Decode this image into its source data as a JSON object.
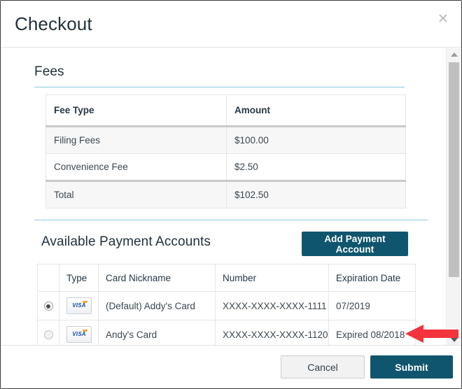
{
  "modal": {
    "title": "Checkout",
    "close_icon": "close-x-icon"
  },
  "fees": {
    "heading": "Fees",
    "columns": [
      "Fee Type",
      "Amount"
    ],
    "rows": [
      {
        "type": "Filing Fees",
        "amount": "$100.00"
      },
      {
        "type": "Convenience Fee",
        "amount": "$2.50"
      },
      {
        "type": "Total",
        "amount": "$102.50"
      }
    ]
  },
  "payment_accounts": {
    "heading": "Available Payment Accounts",
    "add_button_label": "Add Payment Account",
    "columns": [
      "",
      "Type",
      "Card Nickname",
      "Number",
      "Expiration Date"
    ],
    "rows": [
      {
        "selected": "true",
        "card_type": "VISA",
        "nickname": "(Default) Addy's Card",
        "number": "XXXX-XXXX-XXXX-1111",
        "expiration": "07/2019",
        "expired": "false"
      },
      {
        "selected": "false",
        "card_type": "VISA",
        "nickname": "Andy's Card",
        "number": "XXXX-XXXX-XXXX-1120",
        "expiration": "Expired 08/2018",
        "expired": "true"
      }
    ]
  },
  "annotation": {
    "arrow_color": "#f4333c",
    "points_at": "Expired 08/2018"
  },
  "footer": {
    "cancel_label": "Cancel",
    "submit_label": "Submit"
  },
  "colors": {
    "accent_teal": "#10556e",
    "divider_blue": "#8fcbe4",
    "error_red": "#f01616"
  }
}
